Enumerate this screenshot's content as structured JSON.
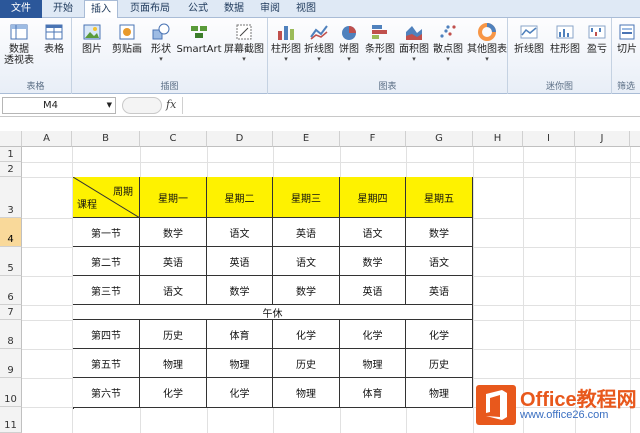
{
  "tabs": [
    "文件",
    "开始",
    "插入",
    "页面布局",
    "公式",
    "数据",
    "审阅",
    "视图"
  ],
  "ribbon": {
    "groups": {
      "table": "表格",
      "illustrations": "插图",
      "charts": "图表",
      "sparklines": "迷你图",
      "filter": "筛选"
    },
    "buttons": {
      "pivot1": "数据",
      "pivot2": "透视表",
      "table": "表格",
      "picture": "图片",
      "clipart": "剪贴画",
      "shapes": "形状",
      "smartart": "SmartArt",
      "screenshot": "屏幕截图",
      "column": "柱形图",
      "line": "折线图",
      "pie": "饼图",
      "bar": "条形图",
      "area": "面积图",
      "scatter": "散点图",
      "other": "其他图表",
      "sp_line": "折线图",
      "sp_column": "柱形图",
      "winloss": "盈亏",
      "slicer": "切片"
    }
  },
  "formula_bar": {
    "name_box": "M4",
    "fx": "fx",
    "content": ""
  },
  "columns": [
    "A",
    "B",
    "C",
    "D",
    "E",
    "F",
    "G",
    "H",
    "I",
    "J"
  ],
  "rows": [
    "1",
    "2",
    "3",
    "4",
    "5",
    "6",
    "7",
    "8",
    "9",
    "10",
    "11"
  ],
  "timetable": {
    "corner_top": "周期",
    "corner_bottom": "课程",
    "days": [
      "星期一",
      "星期二",
      "星期三",
      "星期四",
      "星期五"
    ],
    "break_label": "午休",
    "periods": [
      {
        "label": "第一节",
        "cells": [
          "数学",
          "语文",
          "英语",
          "语文",
          "数学"
        ]
      },
      {
        "label": "第二节",
        "cells": [
          "英语",
          "英语",
          "语文",
          "数学",
          "语文"
        ]
      },
      {
        "label": "第三节",
        "cells": [
          "语文",
          "数学",
          "数学",
          "英语",
          "英语"
        ]
      },
      {
        "label": "第四节",
        "cells": [
          "历史",
          "体育",
          "化学",
          "化学",
          "化学"
        ]
      },
      {
        "label": "第五节",
        "cells": [
          "物理",
          "物理",
          "历史",
          "物理",
          "历史"
        ]
      },
      {
        "label": "第六节",
        "cells": [
          "化学",
          "化学",
          "物理",
          "体育",
          "物理"
        ]
      }
    ]
  },
  "watermark": {
    "brand": "Office教程网",
    "url": "www.office26.com"
  },
  "colors": {
    "header_fill": "#fef200",
    "file_tab": "#2b579a",
    "logo": "#e8581c"
  }
}
